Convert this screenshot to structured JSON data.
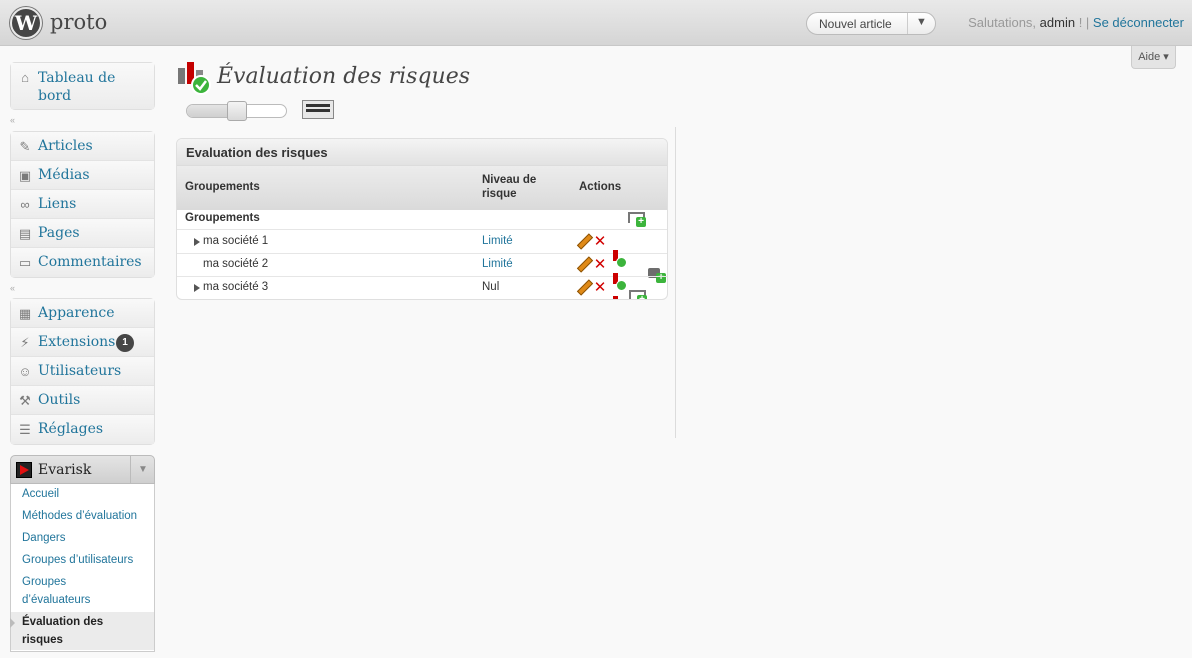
{
  "header": {
    "site_title": "proto",
    "new_post_label": "Nouvel article",
    "new_post_arrow": "▼",
    "greeting": "Salutations,",
    "user": "admin",
    "logout": "Se déconnecter",
    "help": "Aide ▾"
  },
  "sidebar": {
    "dashboard": "Tableau de bord",
    "group1": [
      "Articles",
      "Médias",
      "Liens",
      "Pages",
      "Commentaires"
    ],
    "group2": [
      "Apparence",
      "Extensions",
      "Utilisateurs",
      "Outils",
      "Réglages"
    ],
    "extensions_badge": "1",
    "plugin_menu": "Evarisk",
    "submenu": [
      "Accueil",
      "Méthodes d’évaluation",
      "Dangers",
      "Groupes d’utilisateurs",
      "Groupes",
      "d’évaluateurs",
      "Évaluation des",
      "risques"
    ]
  },
  "page": {
    "title": "Évaluation des risques",
    "slider_level": 0.5
  },
  "panel": {
    "title": "Evaluation des risques",
    "columns": {
      "group": "Groupements",
      "risk_line1": "Niveau de",
      "risk_line2": "risque",
      "actions": "Actions"
    },
    "root_label": "Groupements",
    "rows": [
      {
        "name": "ma société 1",
        "level": "Limité"
      },
      {
        "name": "ma société 2",
        "level": "Limité"
      },
      {
        "name": "ma société 3",
        "level": "Nul"
      }
    ]
  },
  "icons": {
    "logo": "wordpress-logo",
    "dashboard": "home-icon",
    "articles": "pushpin-icon",
    "medias": "camera-icon",
    "links": "chain-icon",
    "pages": "pages-icon",
    "comments": "speech-bubble-icon",
    "appearance": "layout-icon",
    "extensions": "plug-icon",
    "users": "users-icon",
    "tools": "tools-icon",
    "settings": "sliders-icon"
  },
  "colors": {
    "link": "#21759b",
    "header_bg": "#d5d5d5",
    "badge": "#464646",
    "delete": "#d10000",
    "ok_green": "#3cb43c"
  }
}
